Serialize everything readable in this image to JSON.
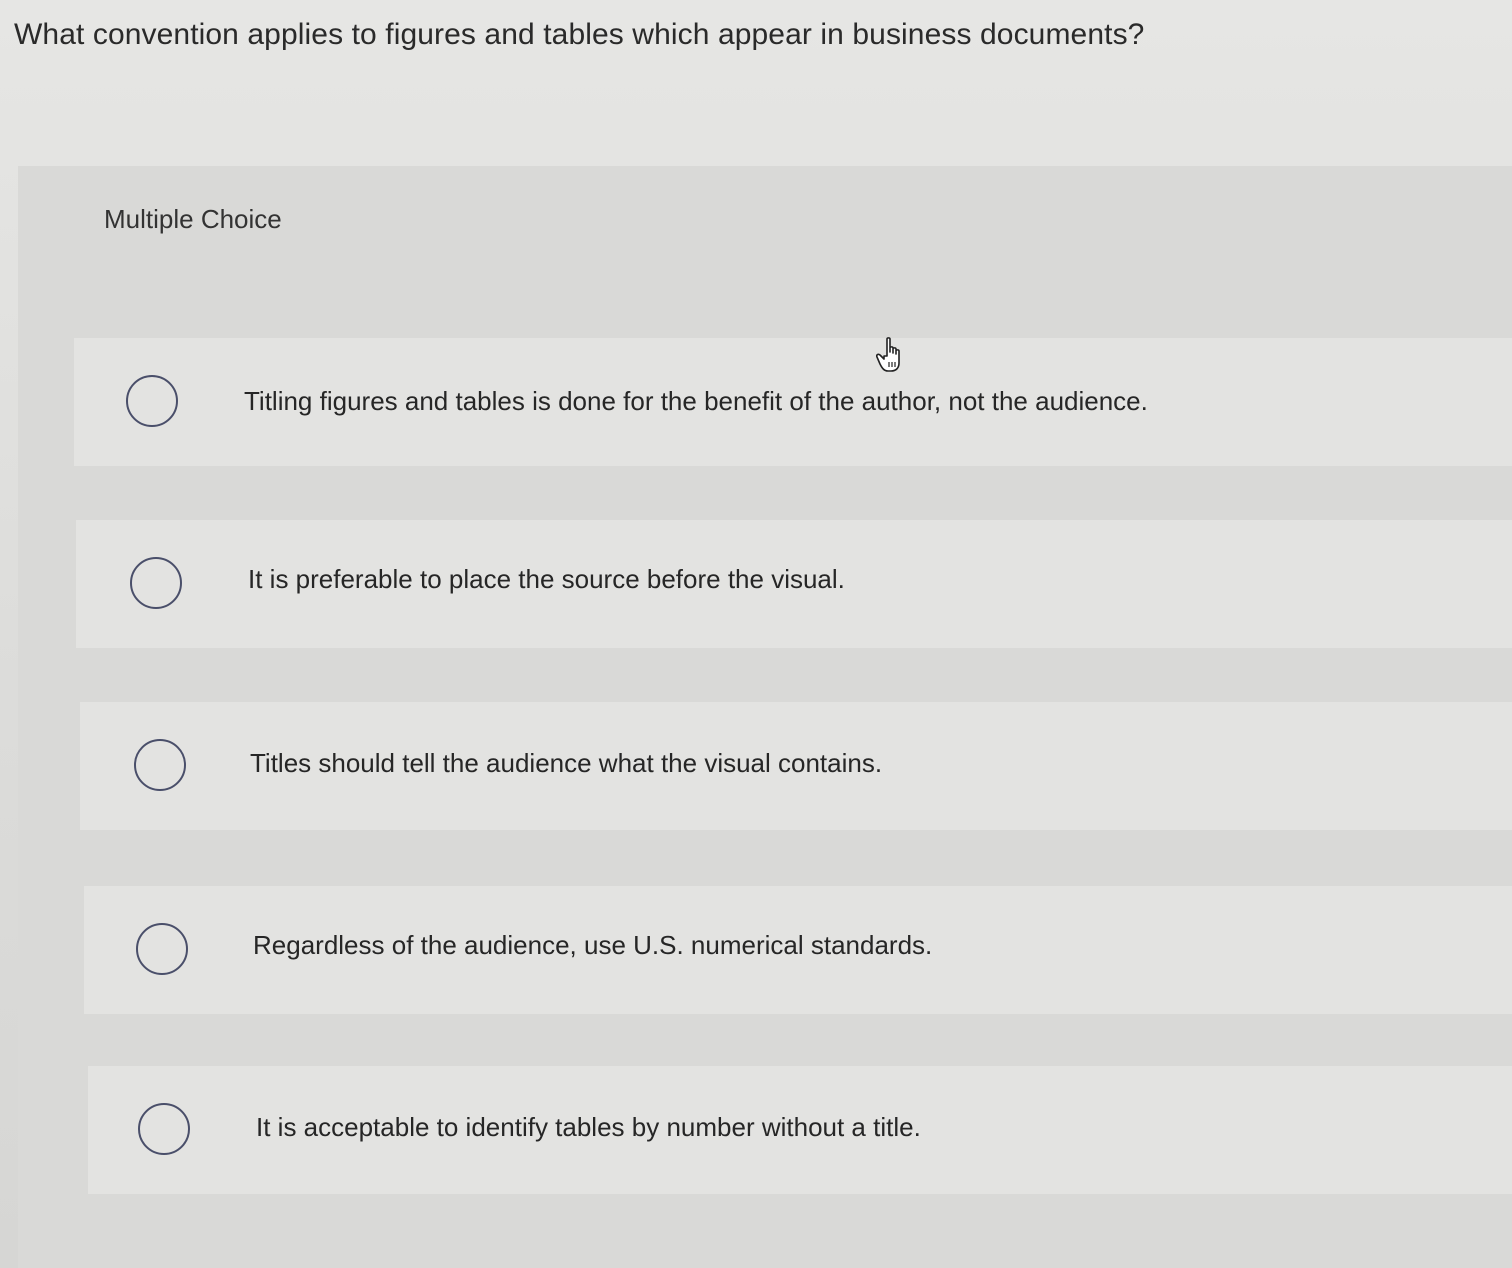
{
  "question": "What convention applies to figures and tables which appear in business documents?",
  "section_label": "Multiple Choice",
  "options": [
    {
      "label": "Titling figures and tables is done for the benefit of the author, not the audience."
    },
    {
      "label": "It is preferable to place the source before the visual."
    },
    {
      "label": "Titles should tell the audience what the visual contains."
    },
    {
      "label": "Regardless of the audience, use U.S. numerical standards."
    },
    {
      "label": "It is acceptable to identify tables by number without a title."
    }
  ],
  "cursor_icon": "hand-pointer-icon",
  "colors": {
    "radio_border": "#4a4f6a",
    "text": "#262626",
    "background": "#dcdcda"
  }
}
